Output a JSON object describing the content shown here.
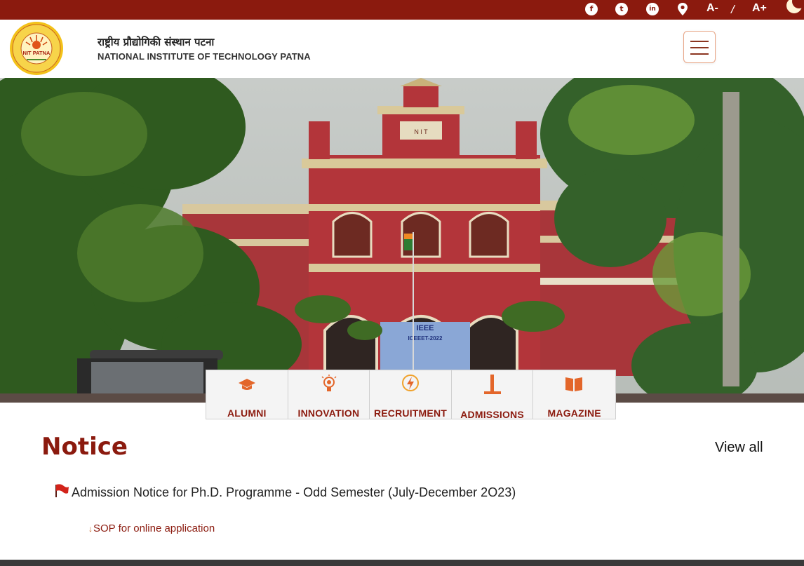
{
  "topbar": {
    "icons": [
      "facebook-icon",
      "twitter-icon",
      "linkedin-icon",
      "location-icon",
      "dark-mode-moon-icon"
    ],
    "font_decrease": "A-",
    "font_separator": "/",
    "font_increase": "A+"
  },
  "header": {
    "title_hindi": "राष्ट्रीय प्रौद्योगिकी संस्थान पटना",
    "title_english": "NATIONAL INSTITUTE OF TECHNOLOGY PATNA",
    "logo_text": "NIT PATNA"
  },
  "hero": {
    "banner_text": "IEEE",
    "banner_subtext": "ICEEET-2022",
    "building_text": "N I T"
  },
  "quick_links": [
    {
      "label": "ALUMNI",
      "icon": "graduation-cap-icon"
    },
    {
      "label": "INNOVATION",
      "icon": "bulb-icon"
    },
    {
      "label": "RECRUITMENT",
      "icon": "lightning-icon"
    },
    {
      "label": "ADMISSIONS",
      "icon": "form-icon"
    },
    {
      "label": "MAGAZINE",
      "icon": "book-icon"
    }
  ],
  "notice": {
    "title": "Notice",
    "view_all": "View all",
    "items": [
      {
        "text": "Admission Notice for Ph.D. Programme - Odd Semester (July-December 2O23)",
        "icon": "red-flag-icon",
        "sub_link": "SOP for online application",
        "sub_icon": "download-arrow-icon"
      }
    ]
  },
  "colors": {
    "brand": "#8b1a0e",
    "accent": "#c9621e",
    "building": "#b3353a"
  }
}
